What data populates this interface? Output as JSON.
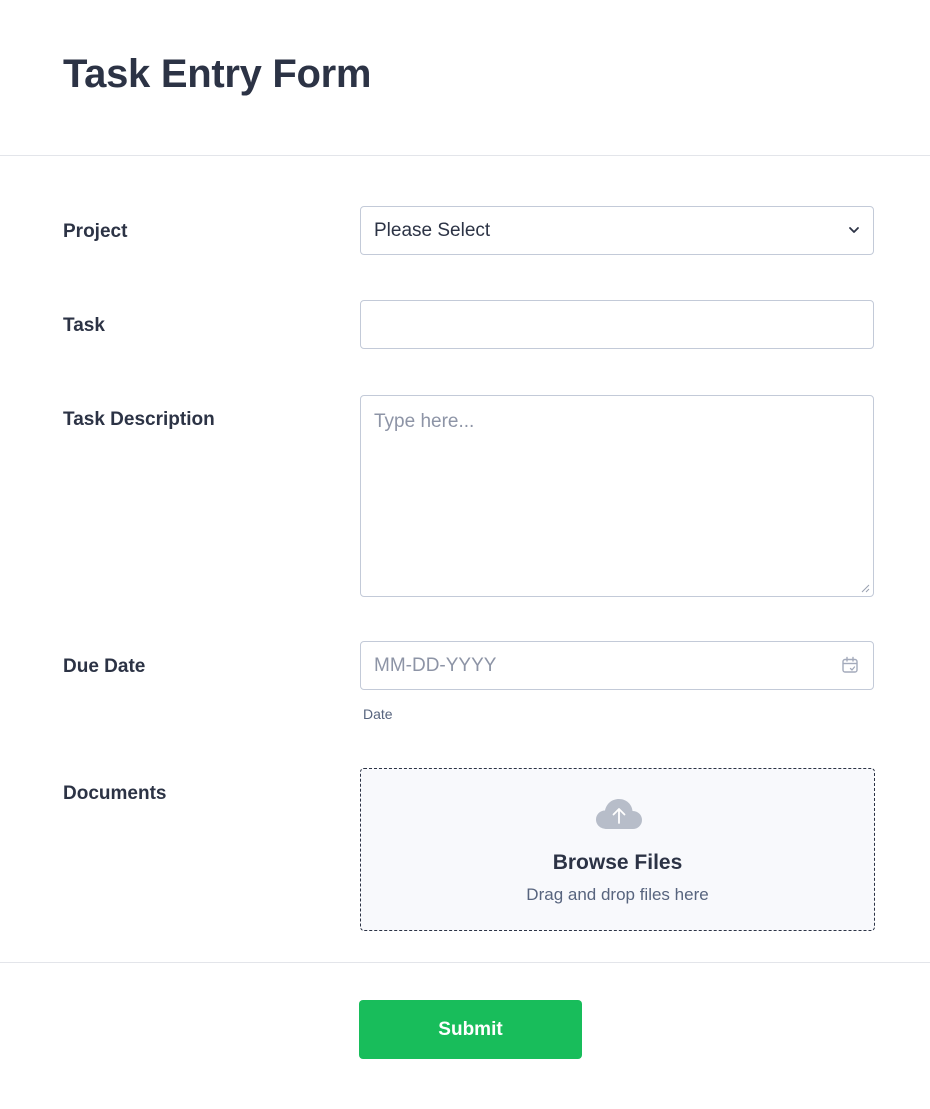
{
  "form": {
    "title": "Task Entry Form"
  },
  "fields": {
    "project": {
      "label": "Project",
      "selected": "Please Select"
    },
    "task": {
      "label": "Task",
      "value": ""
    },
    "description": {
      "label": "Task Description",
      "placeholder": "Type here..."
    },
    "due_date": {
      "label": "Due Date",
      "placeholder": "MM-DD-YYYY",
      "sublabel": "Date"
    },
    "documents": {
      "label": "Documents",
      "browse_title": "Browse Files",
      "browse_sub": "Drag and drop files here"
    }
  },
  "submit": {
    "label": "Submit"
  },
  "colors": {
    "accent": "#18bd5b",
    "text": "#2c3345",
    "border": "#c3cad8"
  },
  "icons": {
    "select": "chevron-down-icon",
    "date": "calendar-icon",
    "upload": "cloud-upload-icon"
  }
}
